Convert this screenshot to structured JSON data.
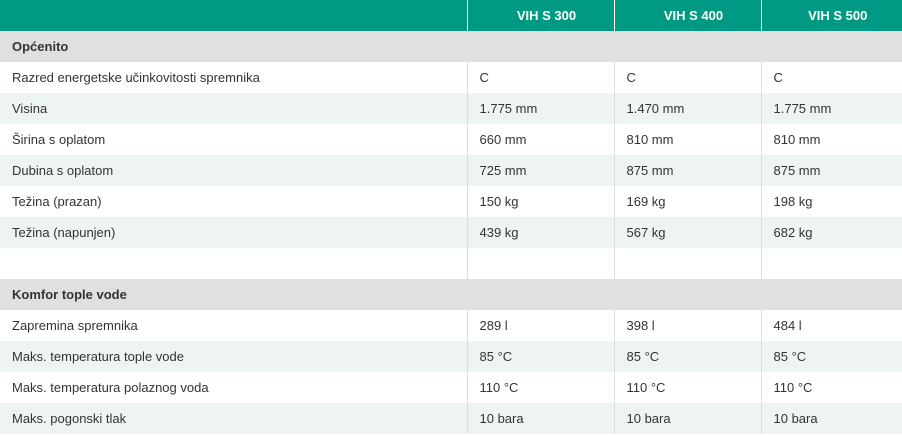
{
  "columns": [
    "",
    "VIH S 300",
    "VIH S 400",
    "VIH S 500"
  ],
  "sections": [
    {
      "title": "Općenito",
      "rows": [
        {
          "label": "Razred energetske učinkovitosti spremnika",
          "values": [
            "C",
            "C",
            "C"
          ]
        },
        {
          "label": "Visina",
          "values": [
            "1.775 mm",
            "1.470 mm",
            "1.775 mm"
          ]
        },
        {
          "label": "Širina s oplatom",
          "values": [
            "660 mm",
            "810 mm",
            "810 mm"
          ]
        },
        {
          "label": "Dubina s oplatom",
          "values": [
            "725 mm",
            "875 mm",
            "875 mm"
          ]
        },
        {
          "label": "Težina (prazan)",
          "values": [
            "150 kg",
            "169 kg",
            "198 kg"
          ]
        },
        {
          "label": "Težina (napunjen)",
          "values": [
            "439 kg",
            "567 kg",
            "682 kg"
          ]
        }
      ]
    },
    {
      "title": "Komfor tople vode",
      "rows": [
        {
          "label": "Zapremina spremnika",
          "values": [
            "289 l",
            "398 l",
            "484 l"
          ]
        },
        {
          "label": "Maks. temperatura tople vode",
          "values": [
            "85 °C",
            "85 °C",
            "85 °C"
          ]
        },
        {
          "label": "Maks. temperatura polaznog voda",
          "values": [
            "110 °C",
            "110 °C",
            "110 °C"
          ]
        },
        {
          "label": "Maks. pogonski tlak",
          "values": [
            "10 bara",
            "10 bara",
            "10 bara"
          ]
        }
      ]
    }
  ],
  "colors": {
    "header_bg": "#009a84",
    "section_bg": "#e0e0e0",
    "alt_row_bg": "#eef4f1"
  }
}
